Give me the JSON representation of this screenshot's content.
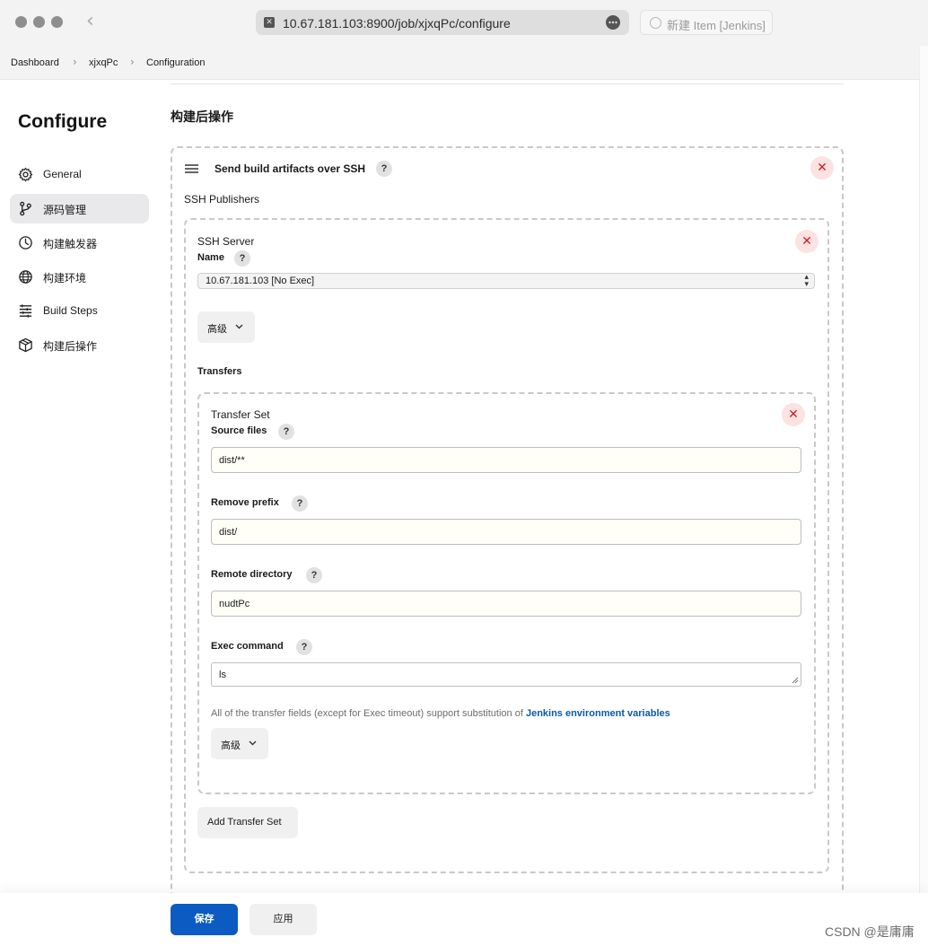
{
  "browser": {
    "url": "10.67.181.103:8900/job/xjxqPc/configure",
    "tab_title": "新建 Item [Jenkins]",
    "back_glyph": "‹",
    "site_icon_glyph": "✕",
    "more_glyph": "•••"
  },
  "breadcrumb": {
    "items": [
      "Dashboard",
      "xjxqPc",
      "Configuration"
    ],
    "separator": "›"
  },
  "sidebar": {
    "title": "Configure",
    "items": [
      {
        "label": "General",
        "icon": "gear-icon",
        "active": false
      },
      {
        "label": "源码管理",
        "icon": "git-branch-icon",
        "active": true
      },
      {
        "label": "构建触发器",
        "icon": "clock-icon",
        "active": false
      },
      {
        "label": "构建环境",
        "icon": "globe-icon",
        "active": false
      },
      {
        "label": "Build Steps",
        "icon": "list-icon",
        "active": false
      },
      {
        "label": "构建后操作",
        "icon": "package-icon",
        "active": false
      }
    ]
  },
  "main": {
    "section_title": "构建后操作",
    "publisher": {
      "title": "Send build artifacts over SSH",
      "subheading": "SSH Publishers",
      "server": {
        "heading": "SSH Server",
        "name_label": "Name",
        "name_value": "10.67.181.103 [No Exec]",
        "advanced_label": "高级"
      },
      "transfers_label": "Transfers",
      "transfer_set": {
        "heading": "Transfer Set",
        "source_files_label": "Source files",
        "source_files_value": "dist/**",
        "remove_prefix_label": "Remove prefix",
        "remove_prefix_value": "dist/",
        "remote_directory_label": "Remote directory",
        "remote_directory_value": "nudtPc",
        "exec_command_label": "Exec command",
        "exec_command_value": "ls",
        "info_text": "All of the transfer fields (except for Exec timeout) support substitution of ",
        "info_link": "Jenkins environment variables",
        "advanced_label": "高级"
      },
      "add_transfer_label": "Add Transfer Set"
    },
    "help_glyph": "?",
    "close_glyph": "✕",
    "chevron_glyph": "⌄"
  },
  "footer": {
    "save_label": "保存",
    "apply_label": "应用"
  },
  "watermark": "CSDN @是庸庸",
  "colors": {
    "primary": "#0b5bc2",
    "link": "#0b57b0",
    "danger": "#d01f1f",
    "danger_bg": "#fde2e2"
  }
}
